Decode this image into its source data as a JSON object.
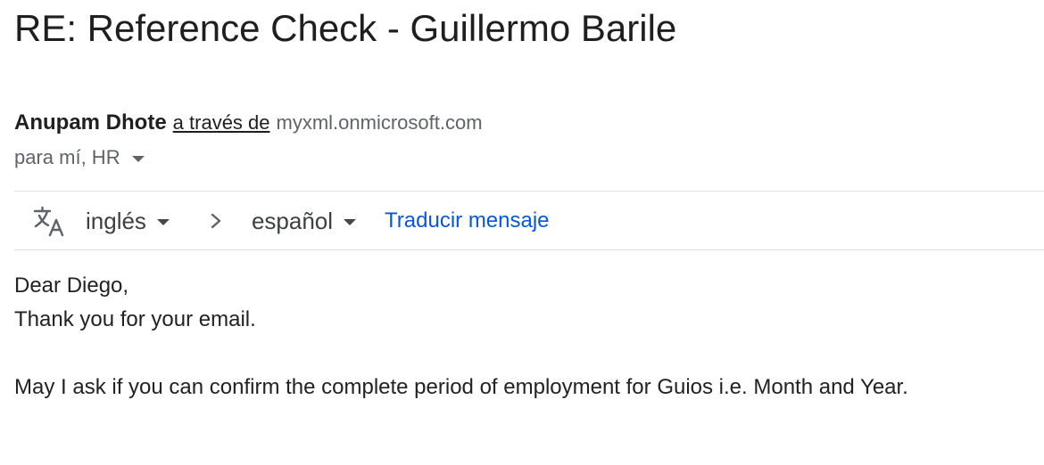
{
  "email": {
    "subject": "RE: Reference Check - Guillermo Barile",
    "sender": {
      "name": "Anupam Dhote",
      "via_label": "a través de",
      "domain": "myxml.onmicrosoft.com"
    },
    "recipients_label": "para mí, HR"
  },
  "translate_bar": {
    "icon": "translate-icon",
    "source_language": "inglés",
    "target_language": "español",
    "translate_link": "Traducir mensaje"
  },
  "message": {
    "lines": [
      "Dear Diego,",
      "Thank you for your email.",
      "",
      "May I ask if you can confirm the complete period of employment for Guios i.e. Month and Year."
    ]
  },
  "colors": {
    "link_blue": "#0b57d0",
    "muted_gray": "#5f6368",
    "divider": "#e0e0e0"
  }
}
